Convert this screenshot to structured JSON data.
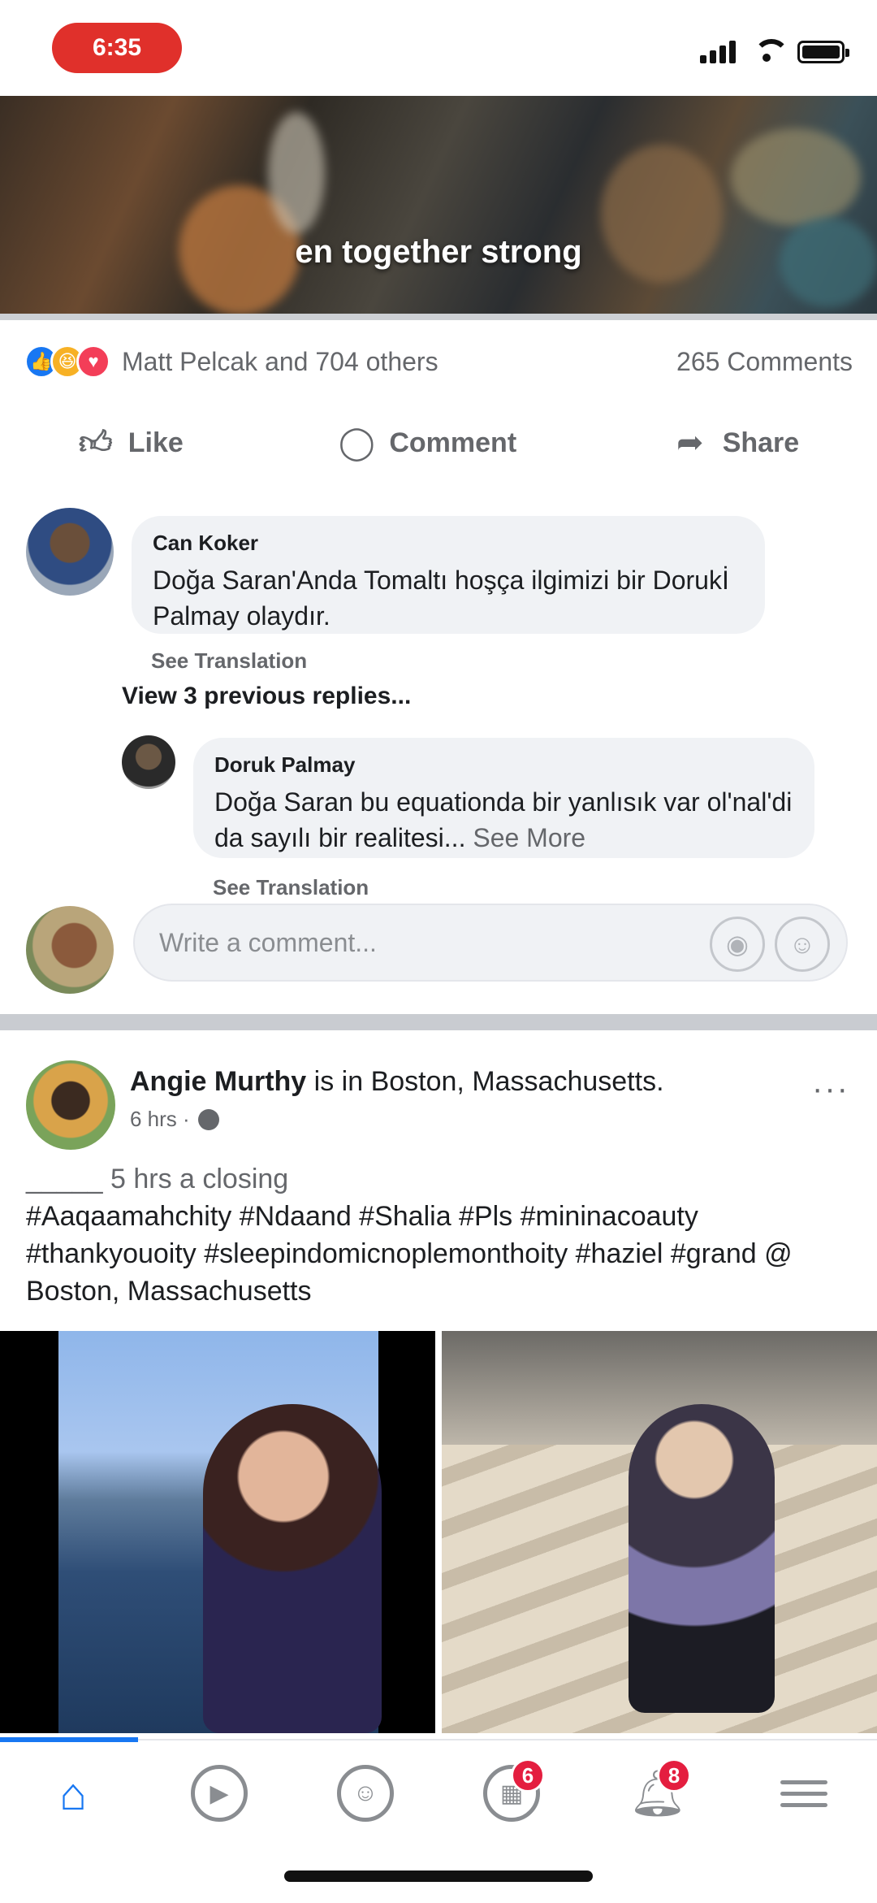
{
  "status_bar": {
    "time": "6:35",
    "pill_color": "#e0302b"
  },
  "post1": {
    "image_caption": "en together strong",
    "reactions": {
      "icons": [
        "like-icon",
        "haha-icon",
        "love-icon"
      ],
      "text": "Matt Pelcak and 704 others",
      "comments": "265 Comments"
    },
    "actions": {
      "like": "Like",
      "comment": "Comment",
      "share": "Share"
    },
    "comments": [
      {
        "author": "Can Koker",
        "text": "Doğa Saran'Anda Tomaltı hoşça ilgimizi bir Dorukİ Palmay olaydır.",
        "see_translation": "See Translation"
      }
    ],
    "view_previous_replies": "View 3 previous replies...",
    "reply": {
      "author": "Doruk Palmay",
      "text": "Doğa Saran bu equationda bir yanlısık var ol'nal'di da sayılı bir realitesi...",
      "see_more": "See More",
      "see_translation": "See Translation"
    },
    "write_comment_placeholder": "Write a comment..."
  },
  "post2": {
    "author": "Angie Murthy",
    "location_phrase": " is in Boston, Massachusetts.",
    "meta": "6 hrs ·",
    "text_line1": "_____ 5 hrs a closing",
    "text_body": "#Aaqaamahchity #Ndaand #Shalia #Pls #mininacoauty #thankyouoity #sleepindomicnoplemonthoity #haziel #grand  @ Boston, Massachusetts",
    "more": "···"
  },
  "bottom_nav": {
    "accent": "#1877f2",
    "items": [
      {
        "name": "home",
        "badge": ""
      },
      {
        "name": "watch",
        "badge": ""
      },
      {
        "name": "groups",
        "badge": ""
      },
      {
        "name": "marketplace",
        "badge": "6"
      },
      {
        "name": "notifications",
        "badge": "8"
      },
      {
        "name": "menu",
        "badge": ""
      }
    ]
  }
}
